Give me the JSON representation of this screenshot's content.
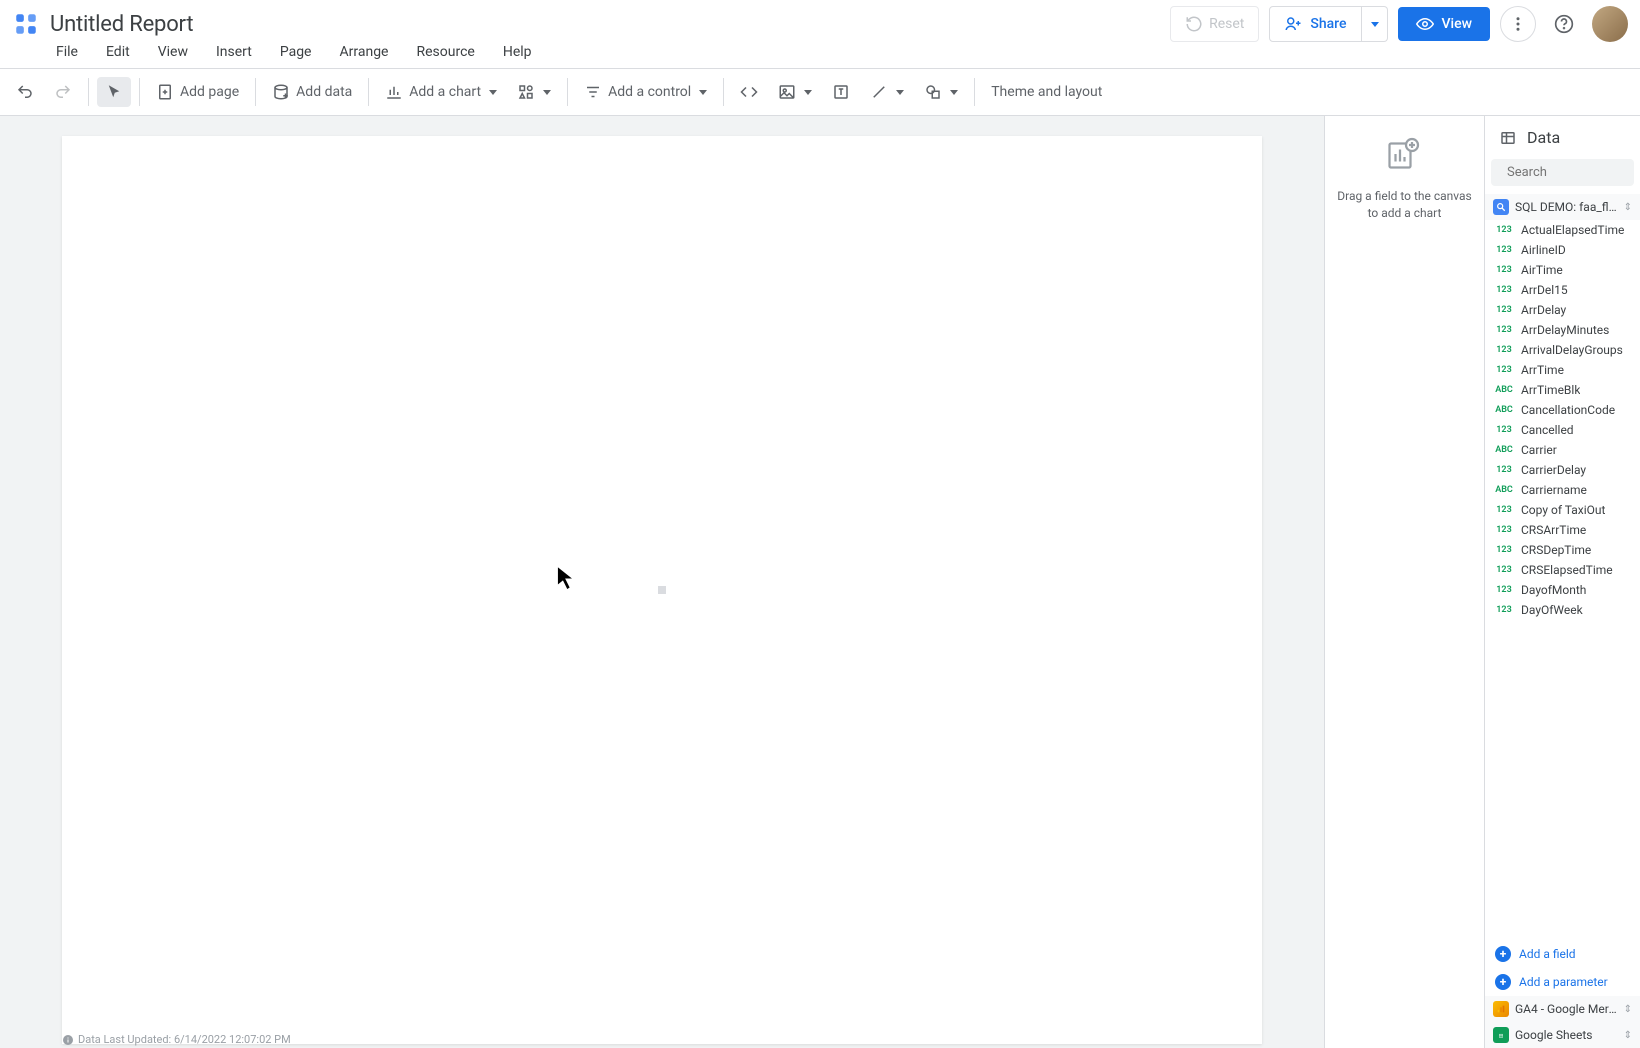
{
  "header": {
    "title": "Untitled Report",
    "reset": "Reset",
    "share": "Share",
    "view": "View"
  },
  "menu": {
    "file": "File",
    "edit": "Edit",
    "view": "View",
    "insert": "Insert",
    "page": "Page",
    "arrange": "Arrange",
    "resource": "Resource",
    "help": "Help"
  },
  "toolbar": {
    "add_page": "Add page",
    "add_data": "Add data",
    "add_chart": "Add a chart",
    "add_control": "Add a control",
    "theme": "Theme and layout"
  },
  "drag_panel": {
    "hint": "Drag a field to the canvas to add a chart"
  },
  "data_panel": {
    "title": "Data",
    "search_placeholder": "Search",
    "datasource": "SQL DEMO: faa_fli…",
    "fields": [
      {
        "type": "123",
        "name": "ActualElapsedTime"
      },
      {
        "type": "123",
        "name": "AirlineID"
      },
      {
        "type": "123",
        "name": "AirTime"
      },
      {
        "type": "123",
        "name": "ArrDel15"
      },
      {
        "type": "123",
        "name": "ArrDelay"
      },
      {
        "type": "123",
        "name": "ArrDelayMinutes"
      },
      {
        "type": "123",
        "name": "ArrivalDelayGroups"
      },
      {
        "type": "123",
        "name": "ArrTime"
      },
      {
        "type": "ABC",
        "name": "ArrTimeBlk"
      },
      {
        "type": "ABC",
        "name": "CancellationCode"
      },
      {
        "type": "123",
        "name": "Cancelled"
      },
      {
        "type": "ABC",
        "name": "Carrier"
      },
      {
        "type": "123",
        "name": "CarrierDelay"
      },
      {
        "type": "ABC",
        "name": "Carriername"
      },
      {
        "type": "123",
        "name": "Copy of TaxiOut"
      },
      {
        "type": "123",
        "name": "CRSArrTime"
      },
      {
        "type": "123",
        "name": "CRSDepTime"
      },
      {
        "type": "123",
        "name": "CRSElapsedTime"
      },
      {
        "type": "123",
        "name": "DayofMonth"
      },
      {
        "type": "123",
        "name": "DayOfWeek"
      }
    ],
    "add_field": "Add a field",
    "add_parameter": "Add a parameter",
    "extra_sources": [
      {
        "icon": "ga",
        "label": "GA4 - Google Merc…"
      },
      {
        "icon": "gs",
        "label": "Google Sheets"
      }
    ]
  },
  "status": "Data Last Updated: 6/14/2022 12:07:02 PM"
}
